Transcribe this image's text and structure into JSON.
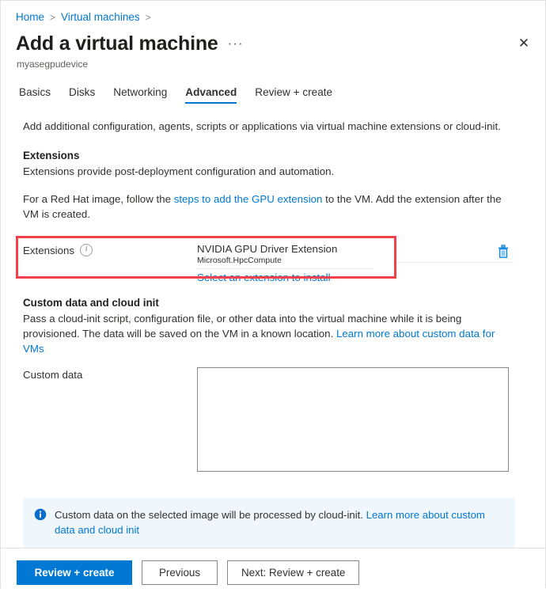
{
  "breadcrumb": {
    "items": [
      {
        "label": "Home"
      },
      {
        "label": "Virtual machines"
      }
    ],
    "separator": ">"
  },
  "header": {
    "title": "Add a virtual machine",
    "more_actions": "···",
    "subtitle": "myasegpudevice",
    "close_label": "✕"
  },
  "tabs": [
    {
      "label": "Basics",
      "active": false
    },
    {
      "label": "Disks",
      "active": false
    },
    {
      "label": "Networking",
      "active": false
    },
    {
      "label": "Advanced",
      "active": true
    },
    {
      "label": "Review + create",
      "active": false
    }
  ],
  "main": {
    "intro": "Add additional configuration, agents, scripts or applications via virtual machine extensions or cloud-init.",
    "extensions_section": {
      "heading": "Extensions",
      "description": "Extensions provide post-deployment configuration and automation.",
      "redhat_note_prefix": "For a Red Hat image, follow the ",
      "redhat_note_link": "steps to add the GPU extension",
      "redhat_note_suffix": " to the VM. Add the extension after the VM is created.",
      "field_label": "Extensions",
      "info_glyph": "i",
      "extension_name": "NVIDIA GPU Driver Extension",
      "extension_publisher": "Microsoft.HpcCompute",
      "select_link": "Select an extension to install",
      "delete_icon_name": "trash-icon"
    },
    "custom_data_section": {
      "heading": "Custom data and cloud init",
      "description_line1": "Pass a cloud-init script, configuration file, or other data into the virtual machine while it is being provisioned.",
      "description_line2_prefix": "The data will be saved on the VM in a known location. ",
      "description_line2_link": "Learn more about custom data for VMs",
      "field_label": "Custom data",
      "textarea_value": "",
      "textarea_placeholder": ""
    },
    "banner": {
      "icon": "info-filled-icon",
      "text_prefix": "Custom data on the selected image will be processed by cloud-init. ",
      "link_text": "Learn more about custom data and cloud init"
    }
  },
  "footer": {
    "review_create_label": "Review + create",
    "previous_label": "Previous",
    "next_label": "Next: Review + create"
  },
  "colors": {
    "accent": "#0078d4",
    "link": "#0078d4",
    "annotation": "#f4404a",
    "banner_bg": "#eff6fc",
    "text": "#323130"
  }
}
